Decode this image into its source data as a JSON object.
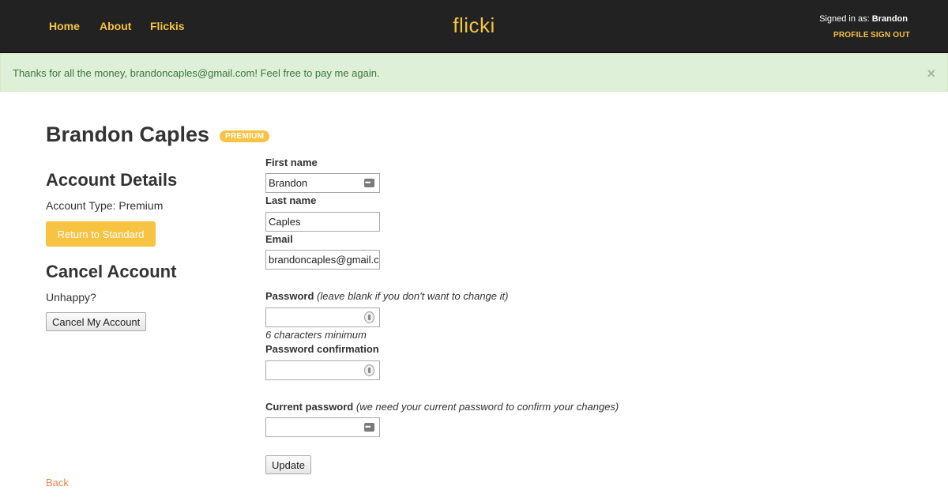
{
  "nav": {
    "home": "Home",
    "about": "About",
    "flickis": "Flickis",
    "brand": "flicki",
    "signed_in_prefix": "Signed in as:",
    "user": "Brandon",
    "profile": "PROFILE",
    "sign_out": "SIGN OUT",
    "accent_color": "#f6c342"
  },
  "alert": {
    "message": "Thanks for all the money, brandoncaples@gmail.com! Feel free to pay me again.",
    "close": "×"
  },
  "profile": {
    "name": "Brandon Caples",
    "badge": "PREMIUM"
  },
  "account": {
    "heading": "Account Details",
    "type_text": "Account Type: Premium",
    "return_button": "Return to Standard"
  },
  "cancel": {
    "heading": "Cancel Account",
    "prompt": "Unhappy?",
    "button": "Cancel My Account"
  },
  "form": {
    "first_name_label": "First name",
    "first_name_value": "Brandon",
    "last_name_label": "Last name",
    "last_name_value": "Caples",
    "email_label": "Email",
    "email_value": "brandoncaples@gmail.com",
    "password_label": "Password",
    "password_note": "(leave blank if you don't want to change it)",
    "password_hint": "6 characters minimum",
    "password_confirm_label": "Password confirmation",
    "current_password_label": "Current password",
    "current_password_note": "(we need your current password to confirm your changes)",
    "update_button": "Update"
  },
  "back_link": "Back"
}
